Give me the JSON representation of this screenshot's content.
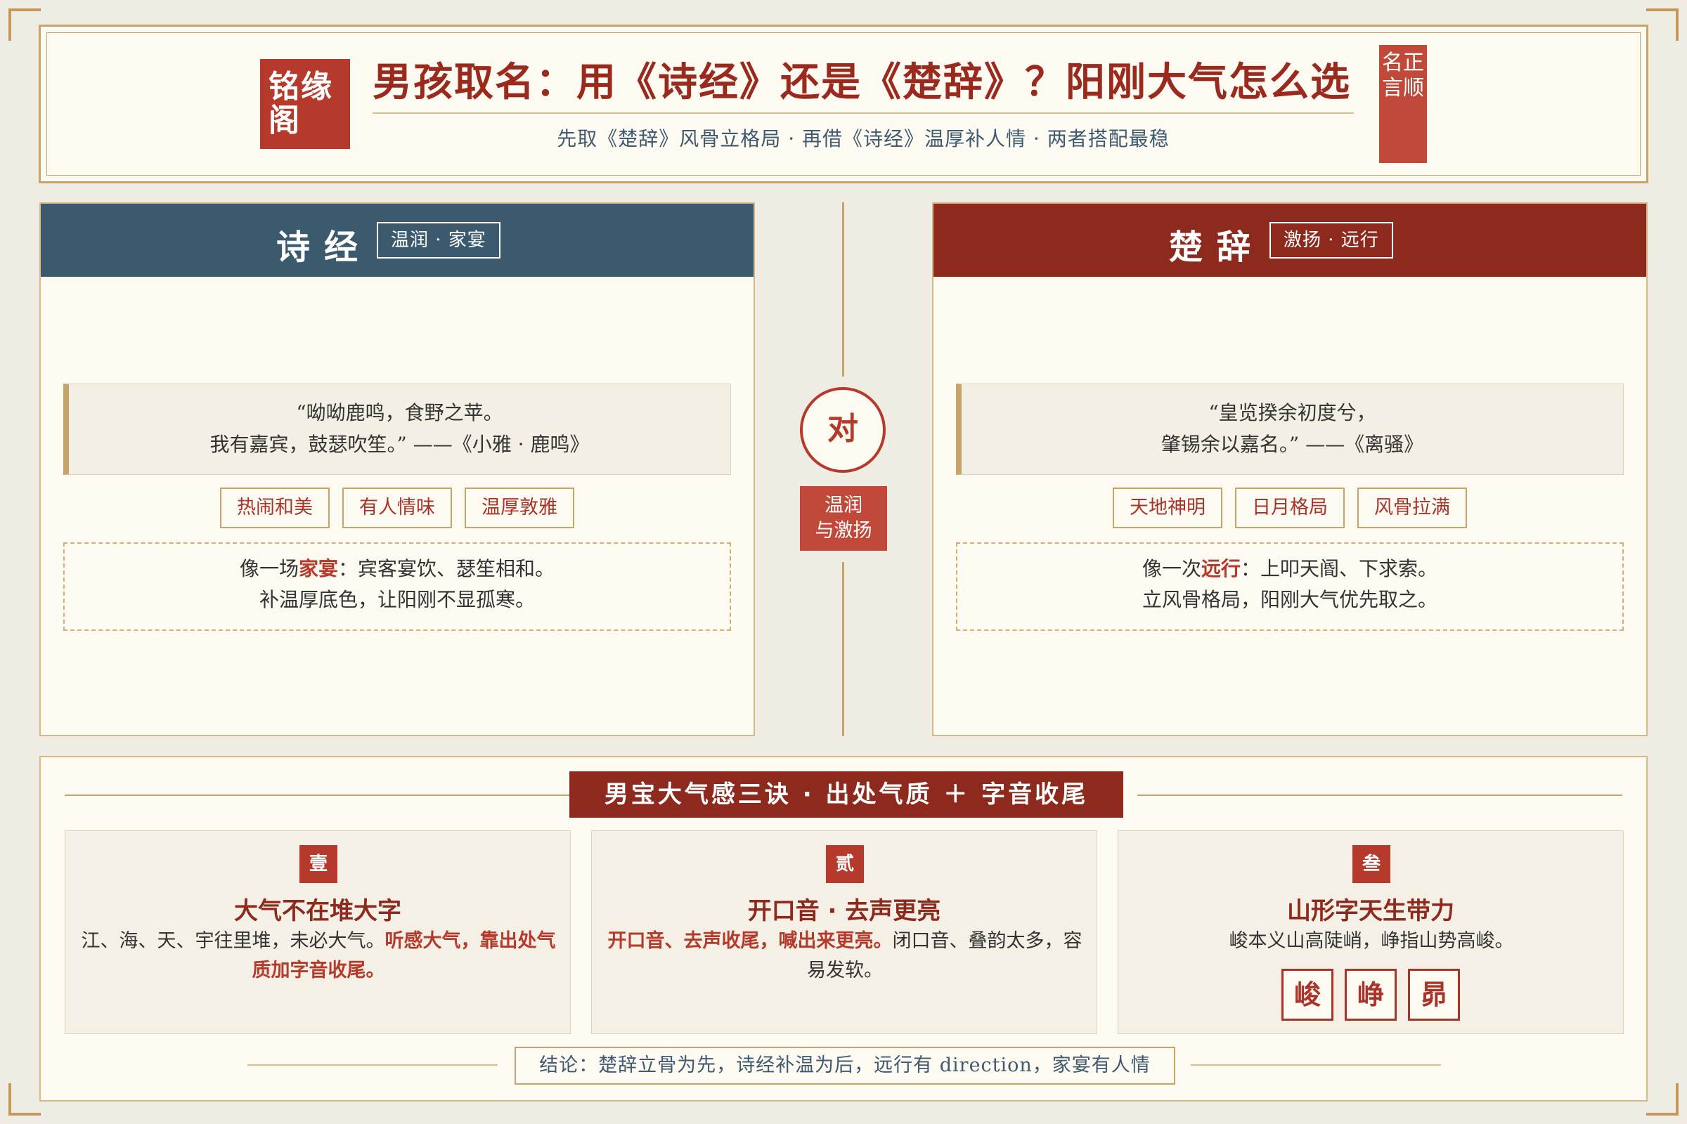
{
  "header": {
    "seal": "铭缘阁",
    "title": "男孩取名：用《诗经》还是《楚辞》？阳刚大气怎么选",
    "subtitle": "先取《楚辞》风骨立格局 · 再借《诗经》温厚补人情 · 两者搭配最稳",
    "right_seal": "名正言顺"
  },
  "left_panel": {
    "title": "诗经",
    "tag": "温润 · 家宴",
    "quote_line1": "“呦呦鹿鸣，食野之苹。",
    "quote_line2": "我有嘉宾，鼓瑟吹笙。” ——《小雅 · 鹿鸣》",
    "chips": [
      "热闹和美",
      "有人情味",
      "温厚敦雅"
    ],
    "note_pre": "像一场",
    "note_hl": "家宴",
    "note_post": "：宾客宴饮、瑟笙相和。",
    "note_line2": "补温厚底色，让阳刚不显孤寒。"
  },
  "right_panel": {
    "title": "楚辞",
    "tag": "激扬 · 远行",
    "quote_line1": "“皇览揆余初度兮，",
    "quote_line2": "肇锡余以嘉名。” ——《离骚》",
    "chips": [
      "天地神明",
      "日月格局",
      "风骨拉满"
    ],
    "note_pre": "像一次",
    "note_hl": "远行",
    "note_post": "：上叩天阍、下求索。",
    "note_line2": "立风骨格局，阳刚大气优先取之。"
  },
  "middle": {
    "vs": "对",
    "badge_line1": "温润",
    "badge_line2": "与激扬"
  },
  "bottom": {
    "title": "男宝大气感三诀 · 出处气质 ＋ 字音收尾",
    "cards": [
      {
        "num": "壹",
        "title": "大气不在堆大字",
        "text_pre": "江、海、天、宇往里堆，未必大气。",
        "text_hl": "听感大气，靠出处气质加字音收尾。",
        "text_post": ""
      },
      {
        "num": "贰",
        "title": "开口音 · 去声更亮",
        "text_pre": "",
        "text_hl": "开口音、去声收尾，喊出来更亮。",
        "text_post": "闭口音、叠韵太多，容易发软。"
      },
      {
        "num": "叁",
        "title": "山形字天生带力",
        "text_pre": "峻本义山高陡峭，峥指山势高峻。",
        "text_hl": "",
        "text_post": "",
        "glyphs": [
          "峻",
          "峥",
          "昴"
        ]
      }
    ],
    "conclusion": "结论：楚辞立骨为先，诗经补温为后，远行有 direction，家宴有人情"
  }
}
